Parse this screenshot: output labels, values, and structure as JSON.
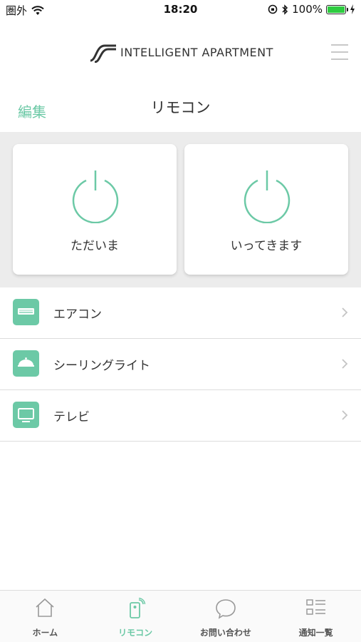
{
  "status_bar": {
    "carrier": "圏外",
    "time": "18:20",
    "battery": "100%"
  },
  "header": {
    "logo_text": "INTELLIGENT APARTMENT"
  },
  "subheader": {
    "edit_label": "編集",
    "title": "リモコン"
  },
  "scenes": [
    {
      "label": "ただいま",
      "icon": "power-icon"
    },
    {
      "label": "いってきます",
      "icon": "power-icon"
    }
  ],
  "devices": [
    {
      "label": "エアコン",
      "icon": "air-conditioner-icon"
    },
    {
      "label": "シーリングライト",
      "icon": "ceiling-light-icon"
    },
    {
      "label": "テレビ",
      "icon": "tv-icon"
    }
  ],
  "tabs": [
    {
      "label": "ホーム",
      "icon": "home-icon"
    },
    {
      "label": "リモコン",
      "icon": "remote-icon",
      "active": true
    },
    {
      "label": "お問い合わせ",
      "icon": "chat-bubble-icon"
    },
    {
      "label": "通知一覧",
      "icon": "list-icon"
    }
  ],
  "colors": {
    "accent": "#6cc9a6",
    "background_gray": "#ececec"
  }
}
